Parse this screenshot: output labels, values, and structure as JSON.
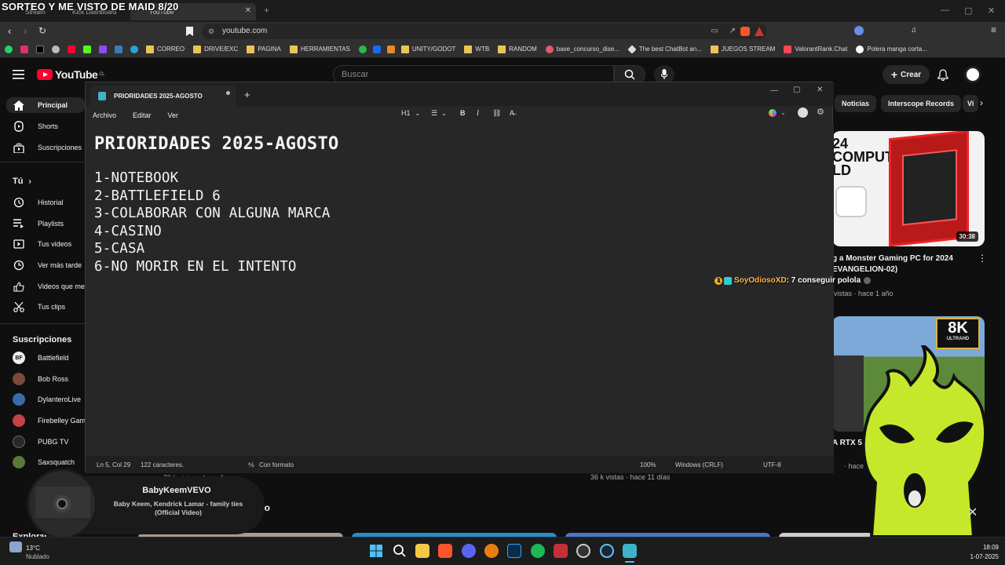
{
  "stream_overlay_title": "SORTEO Y ME VISTO DE MAID 8/20",
  "browser": {
    "tabs": [
      {
        "label": "Stream"
      },
      {
        "label": "Kick Dashboard"
      },
      {
        "label": "YouTube"
      }
    ],
    "url": "youtube.com",
    "bookmarks": [
      {
        "label": "CORREO",
        "folder": true
      },
      {
        "label": "DRIVE/EXC",
        "folder": true
      },
      {
        "label": "PAGINA",
        "folder": true
      },
      {
        "label": "HERRAMIENTAS",
        "folder": true
      },
      {
        "label": "UNITY/GODOT",
        "folder": true
      },
      {
        "label": "WTB",
        "folder": true
      },
      {
        "label": "RANDOM",
        "folder": true
      },
      {
        "label": "base_concurso_dise...",
        "folder": false
      },
      {
        "label": "The best ChatBot an...",
        "folder": false
      },
      {
        "label": "JUEGOS STREAM",
        "folder": true
      },
      {
        "label": "ValorantRank.Chat",
        "folder": false
      },
      {
        "label": "Polera manga corta...",
        "folder": false
      }
    ]
  },
  "youtube": {
    "logo_text": "YouTube",
    "country_code": "CL",
    "search_placeholder": "Buscar",
    "create_label": "Crear",
    "sidebar": {
      "main": [
        {
          "label": "Principal",
          "icon": "home-icon"
        },
        {
          "label": "Shorts",
          "icon": "shorts-icon"
        },
        {
          "label": "Suscripciones",
          "icon": "subscriptions-icon"
        }
      ],
      "you_heading": "Tú",
      "you": [
        {
          "label": "Historial",
          "icon": "history-icon"
        },
        {
          "label": "Playlists",
          "icon": "playlist-icon"
        },
        {
          "label": "Tus videos",
          "icon": "video-icon"
        },
        {
          "label": "Ver más tarde",
          "icon": "clock-icon"
        },
        {
          "label": "Videos que me gustan",
          "icon": "thumbs-up-icon"
        },
        {
          "label": "Tus clips",
          "icon": "scissors-icon"
        }
      ],
      "subs_heading": "Suscripciones",
      "subs": [
        {
          "label": "Battlefield",
          "color": "#eeeeee"
        },
        {
          "label": "Bob Ross",
          "color": "#7a4a3a"
        },
        {
          "label": "DylanteroLive",
          "color": "#3a6aa8"
        },
        {
          "label": "Firebelley Games",
          "color": "#c4424a"
        },
        {
          "label": "PUBG TV",
          "color": "#222222"
        },
        {
          "label": "Saxsquatch",
          "color": "#5a7a3a"
        }
      ],
      "explore_heading": "Explorar"
    },
    "chips": [
      "Noticias",
      "Interscope Records",
      "Vi"
    ],
    "videos": [
      {
        "duration": "30:38",
        "title": "g a Monster Gaming PC for 2024 EVANGELION-02)",
        "meta": "vistas · hace 1 año",
        "thumb_text": "24 COMPUTER LD"
      },
      {
        "thumb_badge": "8K",
        "thumb_badge_sub": "ULTRAHD",
        "title": "A RTX 5",
        "meta": "· hace"
      }
    ],
    "below_meta_left": "79 k vistas · hace 1 mes",
    "below_meta_mid": "36 k vistas · hace 11 días",
    "section_title_partial": "mento"
  },
  "notepad": {
    "tab_title": "PRIORIDADES 2025-AGOSTO",
    "menu": [
      "Archivo",
      "Editar",
      "Ver"
    ],
    "heading_style": "H1",
    "heading": "PRIORIDADES 2025-AGOSTO",
    "lines": [
      "1-NOTEBOOK",
      "2-BATTLEFIELD 6",
      "3-COLABORAR CON ALGUNA MARCA",
      "4-CASINO",
      "5-CASA",
      "6-NO MORIR EN EL INTENTO"
    ],
    "status": {
      "position": "Ln 5, Col 29",
      "chars": "122 caracteres.",
      "format": "Con formato",
      "zoom": "100%",
      "line_ending": "Windows (CRLF)",
      "encoding": "UTF-8"
    }
  },
  "chat": {
    "badge": "1",
    "user": "SoyOdiosoXD",
    "message": ": 7 conseguir polola",
    "user_color": "#ffb84a"
  },
  "now_playing": {
    "artist": "BabyKeemVEVO",
    "song": "Baby Keem, Kendrick Lamar - family ties (Official Video)"
  },
  "taskbar": {
    "weather_temp": "13°C",
    "weather_desc": "Nublado",
    "time": "18:09",
    "date": "1-07-2025"
  },
  "colors": {
    "accent_red": "#ff0033",
    "mascot_green": "#c6e82a"
  }
}
